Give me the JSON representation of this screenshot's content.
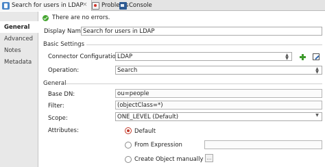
{
  "tabs": [
    {
      "label": "Search for users in LDAP",
      "close": "×"
    },
    {
      "label": "Problems"
    },
    {
      "label": "Console"
    }
  ],
  "sidebar": {
    "items": [
      {
        "label": "General"
      },
      {
        "label": "Advanced"
      },
      {
        "label": "Notes"
      },
      {
        "label": "Metadata"
      }
    ]
  },
  "status": {
    "text": "There are no errors."
  },
  "form": {
    "display_name": {
      "label": "Display Name:",
      "value": "Search for users in LDAP"
    },
    "basic_settings": {
      "title": "Basic Settings",
      "connector_configuration": {
        "label": "Connector Configuration:",
        "value": "LDAP"
      },
      "operation": {
        "label": "Operation:",
        "value": "Search"
      }
    },
    "general": {
      "title": "General",
      "base_dn": {
        "label": "Base DN:",
        "value": "ou=people"
      },
      "filter": {
        "label": "Filter:",
        "value": "(objectClass=*)"
      },
      "scope": {
        "label": "Scope:",
        "value": "ONE_LEVEL (Default)"
      },
      "attributes": {
        "label": "Attributes:",
        "options": [
          {
            "label": "Default",
            "checked": true
          },
          {
            "label": "From Expression",
            "checked": false
          },
          {
            "label": "Create Object manually",
            "checked": false
          }
        ],
        "browse_label": "..."
      }
    }
  },
  "colors": {
    "accent": "#c23a2b",
    "ok": "#46a632",
    "add": "#3e9a2c"
  }
}
